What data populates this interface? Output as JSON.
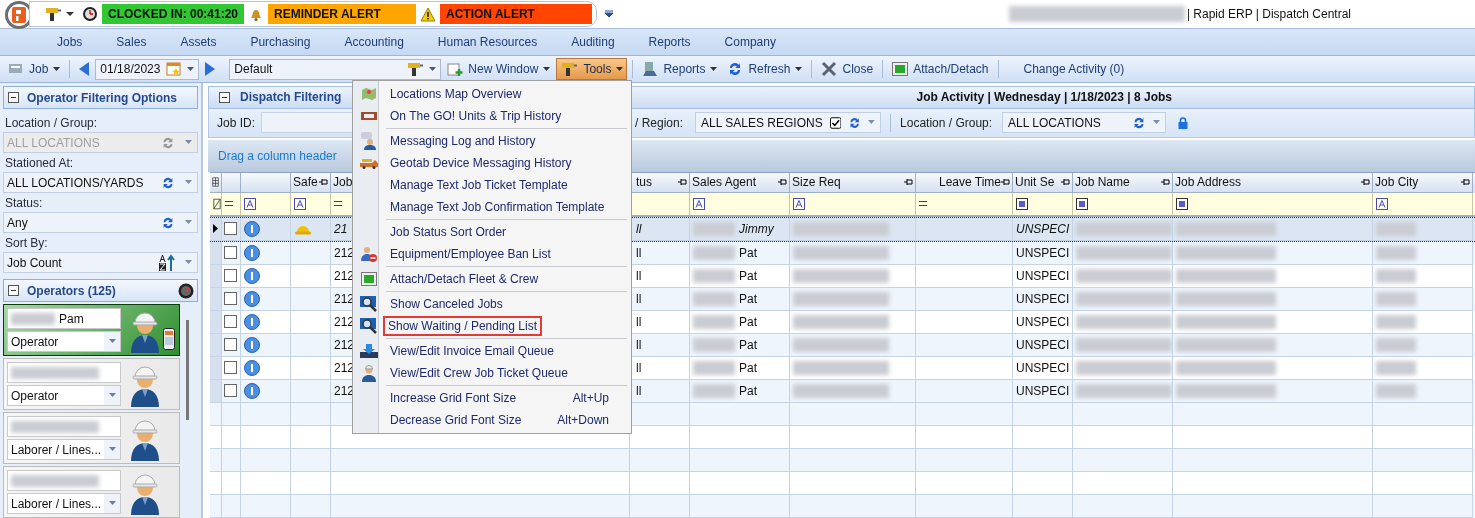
{
  "quick_bar": {
    "clock_status": "CLOCKED IN: 00:41:20",
    "reminder": "REMINDER ALERT",
    "action": "ACTION ALERT"
  },
  "window": {
    "title": "| Rapid ERP | Dispatch Central"
  },
  "menu_bar": [
    {
      "label": "Jobs"
    },
    {
      "label": "Sales"
    },
    {
      "label": "Assets"
    },
    {
      "label": "Purchasing"
    },
    {
      "label": "Accounting"
    },
    {
      "label": "Human Resources"
    },
    {
      "label": "Auditing"
    },
    {
      "label": "Reports"
    },
    {
      "label": "Company"
    }
  ],
  "toolbar": {
    "job": "Job",
    "date": "01/18/2023",
    "layout": "Default",
    "buttons": [
      {
        "label": "New Window",
        "dropdown": true,
        "selected": false
      },
      {
        "label": "Tools",
        "dropdown": true,
        "selected": true
      },
      {
        "label": "Reports",
        "dropdown": true,
        "selected": false
      },
      {
        "label": "Refresh",
        "dropdown": true,
        "selected": false
      },
      {
        "label": "Close",
        "dropdown": false,
        "selected": false
      },
      {
        "label": "Attach/Detach",
        "dropdown": false,
        "selected": false
      },
      {
        "label": "Change Activity (0)",
        "dropdown": false,
        "selected": false
      }
    ]
  },
  "operator_panel": {
    "title": "Operator Filtering Options",
    "fields": [
      {
        "label": "Location / Group:",
        "value": "ALL LOCATIONS",
        "disabled": true,
        "kind": "refresh"
      },
      {
        "label": "Stationed At:",
        "value": "ALL LOCATIONS/YARDS",
        "disabled": false,
        "kind": "refresh"
      },
      {
        "label": "Status:",
        "value": "Any",
        "disabled": false,
        "kind": "refresh"
      },
      {
        "label": "Sort By:",
        "value": "Job Count",
        "disabled": false,
        "kind": "sort"
      }
    ]
  },
  "operators": {
    "title": "Operators (125)",
    "cards": [
      {
        "name": "Pam",
        "role": "Operator",
        "selected": true,
        "mobile": true
      },
      {
        "role": "Operator",
        "selected": false,
        "mobile": false
      },
      {
        "role": "Laborer / Lines...",
        "selected": false,
        "mobile": false
      },
      {
        "role": "Laborer / Lines...",
        "selected": false,
        "mobile": false
      }
    ]
  },
  "dispatch": {
    "title": "Dispatch Filtering",
    "summary": "Job Activity | Wednesday | 1/18/2023 | 8 Jobs",
    "job_id_label": "Job ID:",
    "region_label": "/ Region:",
    "region_value": "ALL SALES REGIONS",
    "region_checked": true,
    "location_label": "Location / Group:",
    "location_value": "ALL LOCATIONS",
    "group_hint": "Drag a column header"
  },
  "tools_menu": {
    "groups": [
      [
        {
          "label": "Locations Map Overview",
          "highlighted": false
        },
        {
          "label": "On The GO! Units & Trip History",
          "highlighted": false
        }
      ],
      [
        {
          "label": "Messaging Log and History",
          "highlighted": false
        },
        {
          "label": "Geotab Device Messaging History",
          "highlighted": false
        },
        {
          "label": "Manage Text Job Ticket Template",
          "highlighted": false
        },
        {
          "label": "Manage Text Job Confirmation Template",
          "highlighted": false
        }
      ],
      [
        {
          "label": "Job Status Sort Order",
          "highlighted": false
        },
        {
          "label": "Equipment/Employee Ban List",
          "highlighted": false
        }
      ],
      [
        {
          "label": "Attach/Detach Fleet & Crew",
          "highlighted": false
        }
      ],
      [
        {
          "label": "Show Canceled Jobs",
          "highlighted": false
        },
        {
          "label": "Show Waiting / Pending List",
          "highlighted": true
        }
      ],
      [
        {
          "label": "View/Edit Invoice Email Queue",
          "highlighted": false
        },
        {
          "label": "View/Edit Crew Job Ticket Queue",
          "highlighted": false
        }
      ],
      [
        {
          "label": "Increase Grid Font Size",
          "shortcut": "Alt+Up",
          "highlighted": false
        },
        {
          "label": "Decrease Grid Font Size",
          "shortcut": "Alt+Down",
          "highlighted": false
        }
      ]
    ]
  },
  "grid": {
    "columns": [
      {
        "kind": "none"
      },
      {
        "kind": "equals"
      },
      {
        "kind": "text"
      },
      {
        "label": "Safe",
        "kind": "text"
      },
      {
        "label": "Job",
        "kind": "equals"
      },
      {
        "label": "tus",
        "kind": "none"
      },
      {
        "label": "Sales Agent",
        "kind": "text"
      },
      {
        "label": "Size Req",
        "kind": "text"
      },
      {
        "label": "Leave Time",
        "kind": "equals"
      },
      {
        "label": "Unit Se",
        "kind": "list"
      },
      {
        "label": "Job Name",
        "kind": "list"
      },
      {
        "label": "Job Address",
        "kind": "list"
      },
      {
        "label": "Job City",
        "kind": "text"
      }
    ],
    "rows": [
      {
        "selected": true,
        "checked": false,
        "safe": true,
        "job_id": "21",
        "status": "ll",
        "sales_agent": "Jimmy",
        "unit_se": "UNSPECI"
      },
      {
        "selected": false,
        "checked": false,
        "safe": false,
        "job_id": "212",
        "status": "ll",
        "sales_agent": "Pat",
        "unit_se": "UNSPECI"
      },
      {
        "selected": false,
        "checked": false,
        "safe": false,
        "job_id": "212",
        "status": "ll",
        "sales_agent": "Pat",
        "unit_se": "UNSPECI"
      },
      {
        "selected": false,
        "checked": false,
        "safe": false,
        "job_id": "212",
        "status": "ll",
        "sales_agent": "Pat",
        "unit_se": "UNSPECI"
      },
      {
        "selected": false,
        "checked": false,
        "safe": false,
        "job_id": "212",
        "status": "ll",
        "sales_agent": "Pat",
        "unit_se": "UNSPECI"
      },
      {
        "selected": false,
        "checked": false,
        "safe": false,
        "job_id": "212",
        "status": "ll",
        "sales_agent": "Pat",
        "unit_se": "UNSPECI"
      },
      {
        "selected": false,
        "checked": false,
        "safe": false,
        "job_id": "212",
        "status": "ll",
        "sales_agent": "Pat",
        "unit_se": "UNSPECI"
      },
      {
        "selected": false,
        "checked": false,
        "safe": false,
        "job_id": "212",
        "status": "ll",
        "sales_agent": "Pat",
        "unit_se": "UNSPECI"
      }
    ]
  }
}
